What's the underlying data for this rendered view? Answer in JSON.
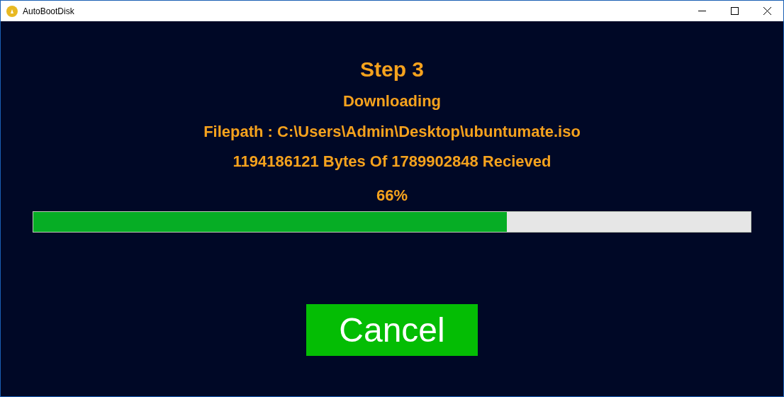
{
  "window": {
    "title": "AutoBootDisk"
  },
  "step": "Step 3",
  "status": "Downloading",
  "filepath": "Filepath : C:\\Users\\Admin\\Desktop\\ubuntumate.iso",
  "bytes": "1194186121 Bytes Of 1789902848 Recieved",
  "progress": {
    "reading": "66%",
    "level": 0.66
  },
  "buttons": [
    {
      "label": "Cancel"
    }
  ]
}
